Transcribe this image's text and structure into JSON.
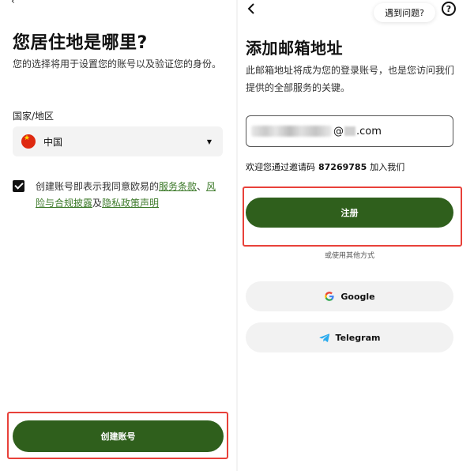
{
  "left": {
    "title": "您居住地是哪里?",
    "description": "您的选择将用于设置您的账号以及验证您的身份。",
    "country_label": "国家/地区",
    "country_value": "中国",
    "agreement_prefix": "创建账号即表示我同意欧易的",
    "agreement_link_terms": "服务条款",
    "agreement_sep": "、",
    "agreement_link_risk": "风险与合规披露",
    "agreement_and": "及",
    "agreement_link_privacy": "隐私政策声明",
    "create_button": "创建账号"
  },
  "right": {
    "help_text": "遇到问题?",
    "title": "添加邮箱地址",
    "description": "此邮箱地址将成为您的登录账号，也是您访问我们提供的全部服务的关键。",
    "email_at": "@",
    "email_domain": ".com",
    "invite_prefix": "欢迎您通过邀请码",
    "invite_code": "87269785",
    "invite_suffix": "加入我们",
    "register_button": "注册",
    "or_text": "或使用其他方式",
    "google_button": "Google",
    "telegram_button": "Telegram"
  },
  "colors": {
    "primary_button": "#2f5f1c",
    "link": "#3d7a2a",
    "highlight_box": "#e8413a",
    "flag_red": "#de2910"
  }
}
